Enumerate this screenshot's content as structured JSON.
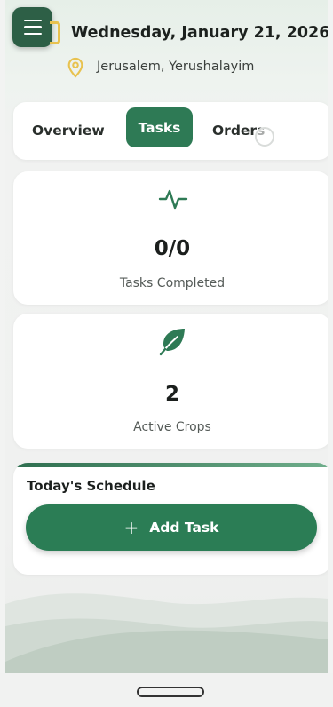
{
  "header": {
    "date": "Wednesday, January 21, 2026",
    "location": "Jerusalem, Yerushalayim",
    "menu_icon": "hamburger-icon",
    "calendar_icon": "calendar-icon",
    "location_icon": "map-pin-icon"
  },
  "tabs": [
    {
      "label": "Overview",
      "active": false
    },
    {
      "label": "Tasks",
      "active": true
    },
    {
      "label": "Orders",
      "active": false
    }
  ],
  "stats": {
    "tasks": {
      "icon": "activity-icon",
      "value": "0/0",
      "label": "Tasks Completed"
    },
    "crops": {
      "icon": "leaf-icon",
      "value": "2",
      "label": "Active Crops"
    }
  },
  "schedule": {
    "title": "Today's Schedule",
    "add_button_icon": "plus-icon",
    "add_button_plus": "+",
    "add_button_label": "Add Task"
  },
  "colors": {
    "primary": "#2e7a55",
    "menu_button": "#2d5f46",
    "accent_yellow": "#e8c24f"
  }
}
